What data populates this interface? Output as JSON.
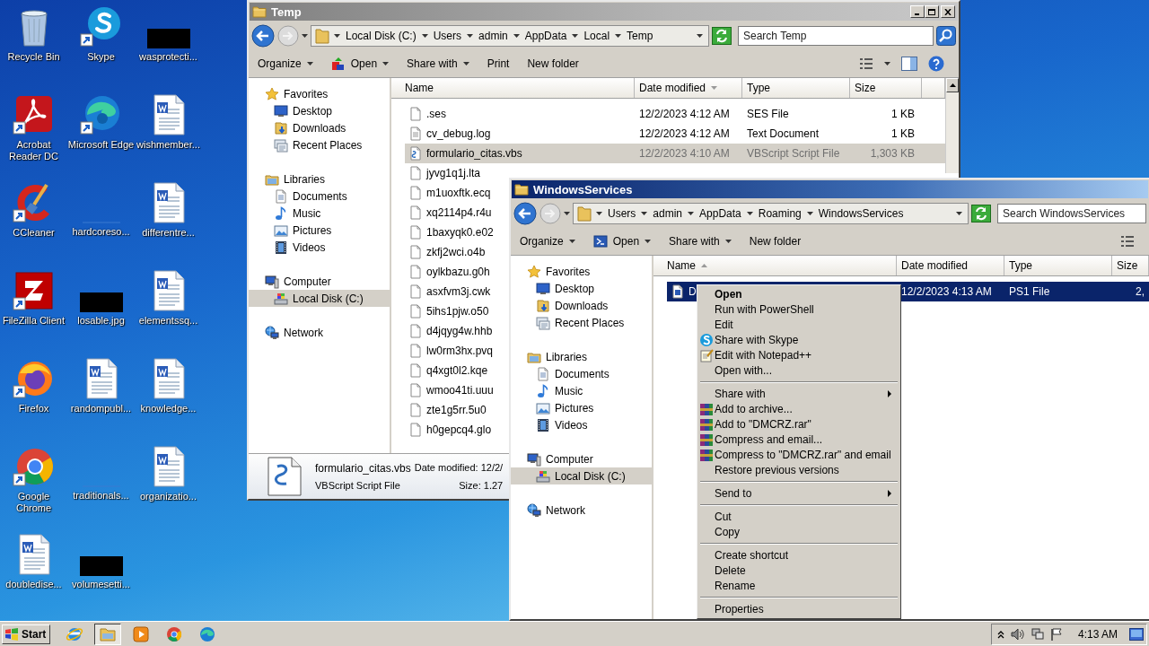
{
  "desktop_icons": [
    {
      "label": "Recycle Bin",
      "kind": "recycle",
      "shortcut": false
    },
    {
      "label": "Skype",
      "kind": "skype",
      "shortcut": true
    },
    {
      "label": "wasprotecti...",
      "kind": "redacted",
      "shortcut": false
    },
    {
      "label": "Acrobat Reader DC",
      "kind": "acrobat",
      "shortcut": true
    },
    {
      "label": "Microsoft Edge",
      "kind": "edge",
      "shortcut": true
    },
    {
      "label": "wishmember...",
      "kind": "word",
      "shortcut": false
    },
    {
      "label": "CCleaner",
      "kind": "ccleaner",
      "shortcut": true
    },
    {
      "label": "hardcoreso...",
      "kind": "blank",
      "shortcut": false
    },
    {
      "label": "differentre...",
      "kind": "word",
      "shortcut": false
    },
    {
      "label": "FileZilla Client",
      "kind": "filezilla",
      "shortcut": true
    },
    {
      "label": "losable.jpg",
      "kind": "redacted",
      "shortcut": false
    },
    {
      "label": "elementssq...",
      "kind": "word",
      "shortcut": false
    },
    {
      "label": "Firefox",
      "kind": "firefox",
      "shortcut": true
    },
    {
      "label": "randompubl...",
      "kind": "word",
      "shortcut": false
    },
    {
      "label": "knowledge...",
      "kind": "word",
      "shortcut": false
    },
    {
      "label": "Google Chrome",
      "kind": "chrome",
      "shortcut": true
    },
    {
      "label": "traditionals...",
      "kind": "blank",
      "shortcut": false
    },
    {
      "label": "organizatio...",
      "kind": "word",
      "shortcut": false
    },
    {
      "label": "doubledise...",
      "kind": "word",
      "shortcut": false
    },
    {
      "label": "volumesetti...",
      "kind": "redacted",
      "shortcut": false
    }
  ],
  "windows": [
    {
      "title": "Temp",
      "active": false,
      "caption_buttons": true,
      "crumbs": [
        "Local Disk (C:)",
        "Users",
        "admin",
        "AppData",
        "Local",
        "Temp"
      ],
      "search_placeholder": "Search Temp",
      "search_button": true,
      "toolbar": [
        {
          "label": "Organize",
          "dropdown": true
        },
        {
          "label": "Open",
          "dropdown": true,
          "kind": "app"
        },
        {
          "label": "Share with",
          "dropdown": true
        },
        {
          "label": "Print",
          "dropdown": false
        },
        {
          "label": "New folder",
          "dropdown": false
        }
      ],
      "toolbar_extras": true,
      "nav": [
        {
          "label": "Favorites",
          "kind": "favorites",
          "selected": false,
          "children": [
            {
              "label": "Desktop",
              "kind": "desktop",
              "selected": false
            },
            {
              "label": "Downloads",
              "kind": "downloads",
              "selected": false
            },
            {
              "label": "Recent Places",
              "kind": "recent",
              "selected": false
            }
          ]
        },
        {
          "label": "Libraries",
          "kind": "libraries",
          "selected": false,
          "children": [
            {
              "label": "Documents",
              "kind": "documents",
              "selected": false
            },
            {
              "label": "Music",
              "kind": "music",
              "selected": false
            },
            {
              "label": "Pictures",
              "kind": "pictures",
              "selected": false
            },
            {
              "label": "Videos",
              "kind": "videos",
              "selected": false
            }
          ]
        },
        {
          "label": "Computer",
          "kind": "computer",
          "selected": false,
          "children": [
            {
              "label": "Local Disk (C:)",
              "kind": "disk",
              "selected": true
            }
          ]
        },
        {
          "label": "Network",
          "kind": "network",
          "selected": false
        }
      ],
      "columns": [
        {
          "label": "Name",
          "kind": "unsorted"
        },
        {
          "label": "Date modified",
          "kind": "descending"
        },
        {
          "label": "Type",
          "kind": "unsorted"
        },
        {
          "label": "Size",
          "kind": "unsorted"
        }
      ],
      "rows": [
        {
          "name": ".ses",
          "date": "12/2/2023 4:12 AM",
          "type": "SES File",
          "size": "1 KB",
          "kind": "file",
          "selected": false
        },
        {
          "name": "cv_debug.log",
          "date": "12/2/2023 4:12 AM",
          "type": "Text Document",
          "size": "1 KB",
          "kind": "text",
          "selected": false
        },
        {
          "name": "formulario_citas.vbs",
          "date": "12/2/2023 4:10 AM",
          "type": "VBScript Script File",
          "size": "1,303 KB",
          "kind": "script",
          "selected": true
        },
        {
          "name": "jyvg1q1j.lta",
          "kind": "file",
          "selected": false
        },
        {
          "name": "m1uoxftk.ecq",
          "kind": "file",
          "selected": false
        },
        {
          "name": "xq2114p4.r4u",
          "kind": "file",
          "selected": false
        },
        {
          "name": "1baxyqk0.e02",
          "kind": "file",
          "selected": false
        },
        {
          "name": "zkfj2wci.o4b",
          "kind": "file",
          "selected": false
        },
        {
          "name": "oylkbazu.g0h",
          "kind": "file",
          "selected": false
        },
        {
          "name": "asxfvm3j.cwk",
          "kind": "file",
          "selected": false
        },
        {
          "name": "5ihs1pjw.o50",
          "kind": "file",
          "selected": false
        },
        {
          "name": "d4jqyg4w.hhb",
          "kind": "file",
          "selected": false
        },
        {
          "name": "lw0rm3hx.pvq",
          "kind": "file",
          "selected": false
        },
        {
          "name": "q4xgt0l2.kqe",
          "kind": "file",
          "selected": false
        },
        {
          "name": "wmoo41ti.uuu",
          "kind": "file",
          "selected": false
        },
        {
          "name": "zte1g5rr.5u0",
          "kind": "file",
          "selected": false
        },
        {
          "name": "h0gepcq4.glo",
          "kind": "file",
          "selected": false
        }
      ],
      "scrollbar": true,
      "details": {
        "name": "formulario_citas.vbs",
        "date": "Date modified: 12/2/",
        "type": "VBScript Script File",
        "size": "Size: 1.27"
      }
    },
    {
      "title": "WindowsServices",
      "active": true,
      "caption_buttons": false,
      "crumbs": [
        "Users",
        "admin",
        "AppData",
        "Roaming",
        "WindowsServices"
      ],
      "search_placeholder": "Search WindowsServices",
      "search_button": false,
      "toolbar": [
        {
          "label": "Organize",
          "dropdown": true
        },
        {
          "label": "Open",
          "dropdown": true,
          "kind": "powershell"
        },
        {
          "label": "Share with",
          "dropdown": true
        },
        {
          "label": "New folder",
          "dropdown": false
        }
      ],
      "toolbar_extras": false,
      "nav": [
        {
          "label": "Favorites",
          "kind": "favorites",
          "selected": false,
          "children": [
            {
              "label": "Desktop",
              "kind": "desktop",
              "selected": false
            },
            {
              "label": "Downloads",
              "kind": "downloads",
              "selected": false
            },
            {
              "label": "Recent Places",
              "kind": "recent",
              "selected": false
            }
          ]
        },
        {
          "label": "Libraries",
          "kind": "libraries",
          "selected": false,
          "children": [
            {
              "label": "Documents",
              "kind": "documents",
              "selected": false
            },
            {
              "label": "Music",
              "kind": "music",
              "selected": false
            },
            {
              "label": "Pictures",
              "kind": "pictures",
              "selected": false
            },
            {
              "label": "Videos",
              "kind": "videos",
              "selected": false
            }
          ]
        },
        {
          "label": "Computer",
          "kind": "computer",
          "selected": false,
          "children": [
            {
              "label": "Local Disk (C:)",
              "kind": "disk",
              "selected": true
            }
          ]
        },
        {
          "label": "Network",
          "kind": "network",
          "selected": false
        }
      ],
      "columns": [
        {
          "label": "Name",
          "kind": "ascending"
        },
        {
          "label": "Date modified",
          "kind": "unsorted"
        },
        {
          "label": "Type",
          "kind": "unsorted"
        },
        {
          "label": "Size",
          "kind": "unsorted"
        }
      ],
      "rows": [
        {
          "name": "D",
          "date": "12/2/2023 4:13 AM",
          "type": "PS1 File",
          "size": "2,",
          "kind": "ps1",
          "selected": true
        }
      ],
      "scrollbar": false
    }
  ],
  "context_menu": {
    "items": [
      {
        "label": "Open",
        "kind": "plain",
        "default": true,
        "submenu": false
      },
      {
        "label": "Run with PowerShell",
        "kind": "plain",
        "default": false,
        "submenu": false
      },
      {
        "label": "Edit",
        "kind": "plain",
        "default": false,
        "submenu": false
      },
      {
        "label": "Share with Skype",
        "kind": "skype",
        "default": false,
        "submenu": false
      },
      {
        "label": "Edit with Notepad++",
        "kind": "notepad",
        "default": false,
        "submenu": false
      },
      {
        "label": "Open with...",
        "kind": "plain",
        "default": false,
        "submenu": false
      },
      {
        "kind": "separator"
      },
      {
        "label": "Share with",
        "kind": "plain",
        "default": false,
        "submenu": true
      },
      {
        "label": "Add to archive...",
        "kind": "archive",
        "default": false,
        "submenu": false
      },
      {
        "label": "Add to \"DMCRZ.rar\"",
        "kind": "archive",
        "default": false,
        "submenu": false
      },
      {
        "label": "Compress and email...",
        "kind": "archive",
        "default": false,
        "submenu": false
      },
      {
        "label": "Compress to \"DMCRZ.rar\" and email",
        "kind": "archive",
        "default": false,
        "submenu": false
      },
      {
        "label": "Restore previous versions",
        "kind": "plain",
        "default": false,
        "submenu": false
      },
      {
        "kind": "separator"
      },
      {
        "label": "Send to",
        "kind": "plain",
        "default": false,
        "submenu": true
      },
      {
        "kind": "separator"
      },
      {
        "label": "Cut",
        "kind": "plain",
        "default": false,
        "submenu": false
      },
      {
        "label": "Copy",
        "kind": "plain",
        "default": false,
        "submenu": false
      },
      {
        "kind": "separator"
      },
      {
        "label": "Create shortcut",
        "kind": "plain",
        "default": false,
        "submenu": false
      },
      {
        "label": "Delete",
        "kind": "plain",
        "default": false,
        "submenu": false
      },
      {
        "label": "Rename",
        "kind": "plain",
        "default": false,
        "submenu": false
      },
      {
        "kind": "separator"
      },
      {
        "label": "Properties",
        "kind": "plain",
        "default": false,
        "submenu": false
      }
    ]
  },
  "taskbar": {
    "start": "Start",
    "apps": [
      {
        "kind": "ie",
        "active": false
      },
      {
        "kind": "explorer",
        "active": true
      },
      {
        "kind": "media",
        "active": false
      },
      {
        "kind": "chrome",
        "active": false
      },
      {
        "kind": "edge",
        "active": false
      }
    ],
    "clock": "4:13 AM"
  }
}
